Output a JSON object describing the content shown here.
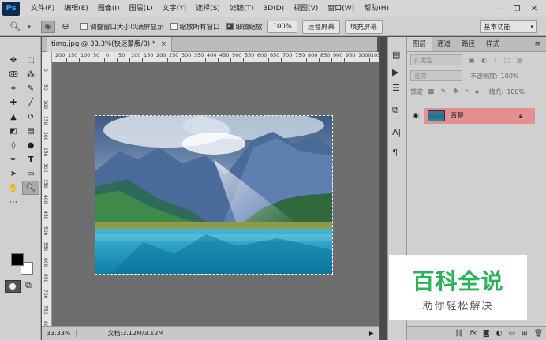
{
  "app": {
    "logo": "Ps"
  },
  "menu": [
    "文件(F)",
    "编辑(E)",
    "图像(I)",
    "图层(L)",
    "文字(Y)",
    "选择(S)",
    "滤镜(T)",
    "3D(D)",
    "视图(V)",
    "窗口(W)",
    "帮助(H)"
  ],
  "window_controls": {
    "minimize": "—",
    "restore": "❐",
    "close": "✕"
  },
  "options": {
    "resize_windows": "调整窗口大小以满屏显示",
    "zoom_all": "缩放所有窗口",
    "scrubby_zoom": "细微缩放",
    "zoom_value": "100%",
    "fit_screen": "适合屏幕",
    "fill_screen": "填充屏幕",
    "workspace": "基本功能"
  },
  "document": {
    "tab": "timg.jpg @ 33.3%(快速蒙版/8) *",
    "close": "×",
    "ruler_x": [
      "200",
      "150",
      "100",
      "50",
      "0",
      "50",
      "100",
      "150",
      "200",
      "250",
      "300",
      "350",
      "400",
      "450",
      "500",
      "550",
      "600",
      "650",
      "700",
      "750",
      "800",
      "850",
      "900",
      "950",
      "1000",
      "1050"
    ],
    "ruler_y": [
      "0",
      "50",
      "100",
      "150",
      "200",
      "250",
      "300",
      "350",
      "400",
      "450",
      "500",
      "550",
      "600",
      "650",
      "700",
      "750",
      "800"
    ]
  },
  "status": {
    "zoom": "33.33%",
    "doc": "文档:3.12M/3.12M",
    "arrow": "▶"
  },
  "layers_panel": {
    "tabs": [
      "图层",
      "通道",
      "路径",
      "样式"
    ],
    "menu_icon": "≡",
    "kind_filter": "ρ 类型",
    "blend_mode": "正常",
    "opacity_label": "不透明度:",
    "opacity_value": "100%",
    "lock_label": "锁定:",
    "fill_label": "填充:",
    "fill_value": "100%",
    "layer_name": "背景",
    "eye": "👁",
    "lock": "🔒"
  },
  "watermark": {
    "title": "百科全说",
    "subtitle": "助你轻松解决"
  }
}
